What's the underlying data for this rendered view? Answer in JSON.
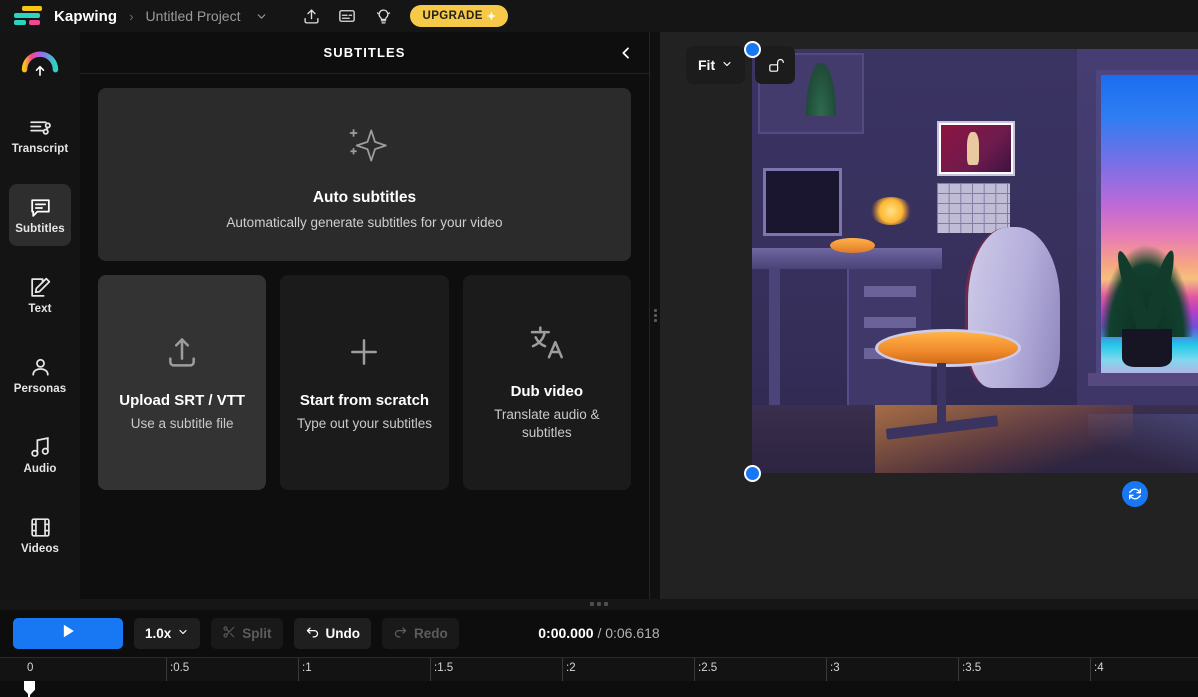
{
  "topbar": {
    "brand": "Kapwing",
    "breadcrumb_separator": "›",
    "project_name": "Untitled Project",
    "project_chevron": "⌄",
    "icons": {
      "export": "export-upload-icon",
      "captions": "captions-card-icon",
      "tips": "lightbulb-icon"
    },
    "upgrade_label": "UPGRADE",
    "upgrade_sparkle": "✦",
    "upgrade_color": "#f7c948"
  },
  "rail": {
    "upload_icon": "cloud-upload-icon",
    "items": [
      {
        "label": "Transcript",
        "icon": "transcript-icon",
        "active": false
      },
      {
        "label": "Subtitles",
        "icon": "subtitles-icon",
        "active": true
      },
      {
        "label": "Text",
        "icon": "text-edit-icon",
        "active": false
      },
      {
        "label": "Personas",
        "icon": "person-icon",
        "active": false
      },
      {
        "label": "Audio",
        "icon": "music-note-icon",
        "active": false
      },
      {
        "label": "Videos",
        "icon": "film-strip-icon",
        "active": false
      }
    ]
  },
  "panel": {
    "title": "SUBTITLES",
    "collapse_icon": "chevron-left-icon",
    "auto_card": {
      "icon": "sparkle-icon",
      "title": "Auto subtitles",
      "subtitle": "Automatically generate subtitles for your video"
    },
    "options": [
      {
        "icon": "upload-arrow-icon",
        "title": "Upload SRT / VTT",
        "subtitle": "Use a subtitle file",
        "hovered": true
      },
      {
        "icon": "plus-icon",
        "title": "Start from scratch",
        "subtitle": "Type out your subtitles",
        "hovered": false
      },
      {
        "icon": "translate-icon",
        "title": "Dub video",
        "subtitle": "Translate audio & subtitles",
        "hovered": false
      }
    ]
  },
  "preview": {
    "zoom_label": "Fit",
    "zoom_chevron": "⌄",
    "lock_icon": "unlocked-padlock-icon",
    "refresh_icon": "refresh-loop-icon",
    "accent_color": "#1877f2",
    "scene_description": "lofi bedroom at sunset with desk chair, window and plant"
  },
  "timeline": {
    "play_icon": "play-triangle-icon",
    "speed_label": "1.0x",
    "speed_chevron": "⌄",
    "split_label": "Split",
    "split_icon": "scissors-icon",
    "split_disabled": true,
    "undo_label": "Undo",
    "undo_icon": "undo-arrow-icon",
    "undo_disabled": false,
    "redo_label": "Redo",
    "redo_icon": "redo-arrow-icon",
    "redo_disabled": true,
    "current_time": "0:00.000",
    "time_separator": "/",
    "total_time": "0:06.618",
    "ruler_ticks": [
      "0",
      ":0.5",
      ":1",
      ":1.5",
      ":2",
      ":2.5",
      ":3",
      ":3.5",
      ":4"
    ],
    "playhead_position": "0"
  }
}
